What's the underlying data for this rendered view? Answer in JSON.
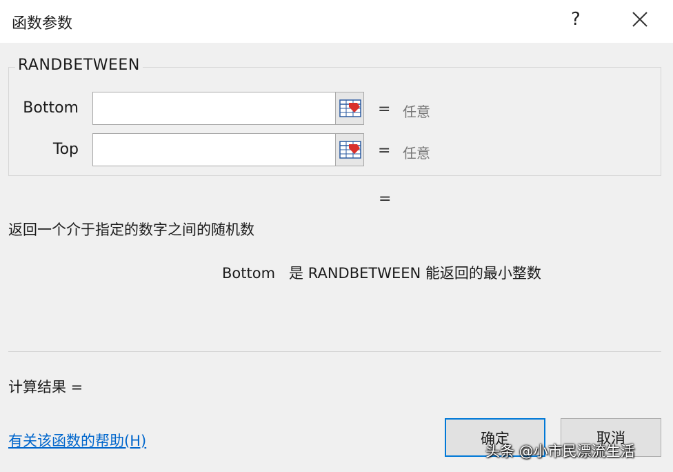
{
  "dialog": {
    "title": "函数参数",
    "help_symbol": "?"
  },
  "function": {
    "name": "RANDBETWEEN",
    "args": [
      {
        "label": "Bottom",
        "value": "",
        "eq": "=",
        "result": "任意"
      },
      {
        "label": "Top",
        "value": "",
        "eq": "=",
        "result": "任意"
      }
    ],
    "result_eq": "=",
    "description": "返回一个介于指定的数字之间的随机数",
    "param_description": "Bottom   是 RANDBETWEEN 能返回的最小整数"
  },
  "footer": {
    "calc_result": "计算结果 =",
    "help_link": "有关该函数的帮助(H)",
    "ok_label": "确定",
    "cancel_label": "取消"
  },
  "watermark": "头条 @小市民漂流生活",
  "colors": {
    "accent": "#0078d7",
    "link": "#0066cc",
    "background": "#f0f0f0"
  },
  "icons": {
    "collapse_dialog": "range-selector-icon",
    "close": "close-icon"
  }
}
